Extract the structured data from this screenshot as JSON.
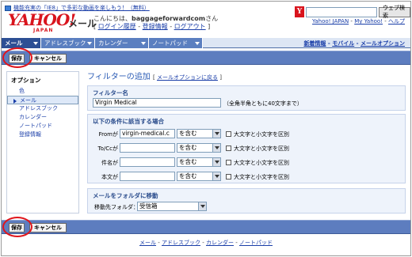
{
  "promo": {
    "text": "機能充実の「IE8」で多彩な動画を楽しもう！（無料）"
  },
  "logo": {
    "brand": "YAHOO!",
    "sub": "JAPAN",
    "service": "メール"
  },
  "greeting": {
    "prefix": "こんにちは、",
    "username": "baggageforwardcom",
    "suffix": "さん",
    "login_history": "ログイン履歴",
    "account_info": "登録情報",
    "logout": "ログアウト"
  },
  "search": {
    "button": "ウェブ検索",
    "value": ""
  },
  "top_links": {
    "yahoo_japan": "Yahoo! JAPAN",
    "my_yahoo": "My Yahoo!",
    "help": "ヘルプ"
  },
  "tabs": [
    {
      "label": "メール"
    },
    {
      "label": "アドレスブック"
    },
    {
      "label": "カレンダー"
    },
    {
      "label": "ノートパッド"
    }
  ],
  "right_links": {
    "news": "新着情報",
    "mobile": "モバイル",
    "mail_options": "メールオプション"
  },
  "buttons": {
    "save": "保存",
    "cancel": "キャンセル"
  },
  "sidebar": {
    "header": "オプション",
    "items": [
      {
        "label": "色"
      },
      {
        "label": "メール"
      },
      {
        "label": "アドレスブック"
      },
      {
        "label": "カレンダー"
      },
      {
        "label": "ノートパッド"
      },
      {
        "label": "登録情報"
      }
    ]
  },
  "page": {
    "title": "フィルターの追加",
    "back_link": "メールオプションに戻る"
  },
  "filter_name": {
    "label": "フィルター名",
    "value": "Virgin Medical",
    "hint": "（全角半角ともに40文字まで）"
  },
  "conditions": {
    "label": "以下の条件に該当する場合",
    "case_label": "大文字と小文字を区別",
    "rows": [
      {
        "field": "Fromが",
        "value": "virgin-medical.c",
        "match": "を含む"
      },
      {
        "field": "To/Ccが",
        "value": "",
        "match": "を含む"
      },
      {
        "field": "件名が",
        "value": "",
        "match": "を含む"
      },
      {
        "field": "本文が",
        "value": "",
        "match": "を含む"
      }
    ]
  },
  "move": {
    "label": "メールをフォルダに移動",
    "folder_label": "移動先フォルダ：",
    "folder_value": "受信箱"
  },
  "footer": {
    "mail": "メール",
    "address_book": "アドレスブック",
    "calendar": "カレンダー",
    "notepad": "ノートパッド"
  },
  "colors": {
    "accent": "#2d4f94",
    "bar": "#5d7dbf",
    "highlight_ring": "#e0151b",
    "logo": "#d9141d"
  }
}
